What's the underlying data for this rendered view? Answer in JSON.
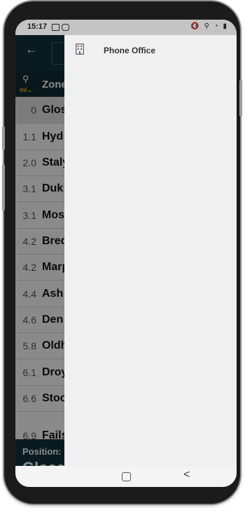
{
  "status_bar": {
    "time": "15:17",
    "right_icons": "🔇 ⚲ ◔ ▮"
  },
  "background_app": {
    "zone_header": "Zone",
    "unit_label": "mi⌄",
    "rows": [
      {
        "distance": "0",
        "name": "Glos"
      },
      {
        "distance": "1.1",
        "name": "Hyd"
      },
      {
        "distance": "2.0",
        "name": "Staly"
      },
      {
        "distance": "3.1",
        "name": "Duk"
      },
      {
        "distance": "3.1",
        "name": "Mos"
      },
      {
        "distance": "4.2",
        "name": "Bred"
      },
      {
        "distance": "4.2",
        "name": "Marp"
      },
      {
        "distance": "4.4",
        "name": "Ash"
      },
      {
        "distance": "4.6",
        "name": "Den"
      },
      {
        "distance": "5.8",
        "name": "Oldh"
      },
      {
        "distance": "6.1",
        "name": "Droy"
      },
      {
        "distance": "6.6",
        "name": "Stoc"
      },
      {
        "distance": "6.9",
        "name": "Fails"
      }
    ],
    "position_label": "Position:",
    "position_value": "Gloss"
  },
  "drawer": {
    "items": [
      {
        "label": "Phone Office",
        "icon": "building-icon"
      }
    ]
  },
  "nav_bar": {
    "home": "home-button",
    "back": "back-button"
  }
}
